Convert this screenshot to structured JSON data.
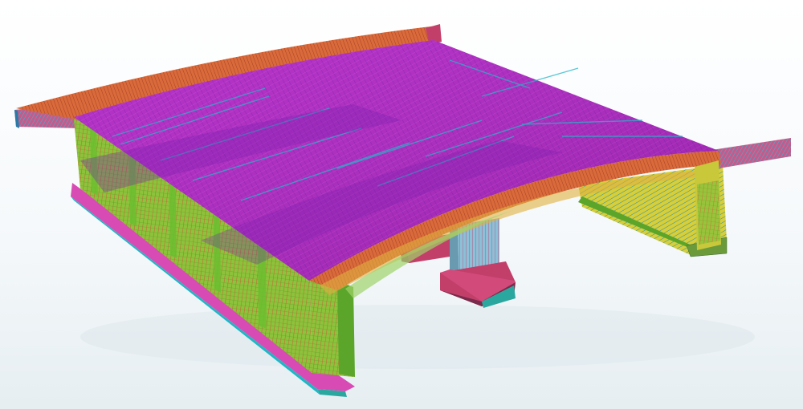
{
  "viewport": {
    "background_top": "#ffffff",
    "background_bottom": "#e6eef2"
  },
  "model": {
    "view": "isometric-3d",
    "render_mode": "mesh-wireframe",
    "colors": {
      "deck_top": "#b026c4",
      "deck_top_dark": "#8a1fb4",
      "deck_mesh_accent": "#23b6c9",
      "deck_edge": "#d96a3a",
      "deck_edge_dark": "#b84a2c",
      "girder_face": "#7fc23a",
      "girder_face_dark": "#4e9a2a",
      "girder_mesh": "#c96a3a",
      "girder_bottom": "#d94bb4",
      "girder_bottom_edge": "#1fb7c4",
      "pier_column": "#8cc0d8",
      "pier_footing": "#c23f6a",
      "pier_cap": "#9a8a9a",
      "wing_mesh": "#3ab4d6",
      "cantilever_yellow": "#e6d230"
    }
  }
}
